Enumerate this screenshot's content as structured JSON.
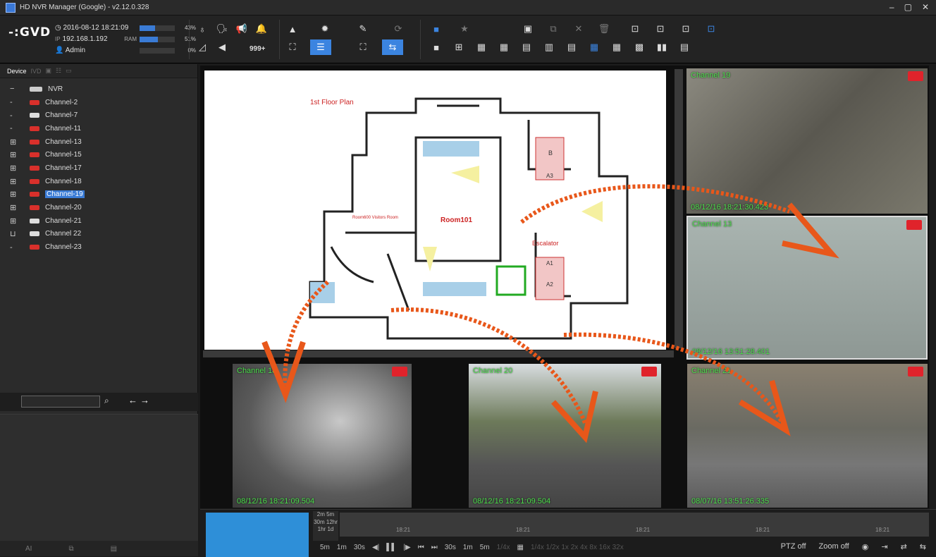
{
  "window": {
    "title": "HD NVR Manager (Google) - v2.12.0.328",
    "controls": [
      "–",
      "▢",
      "✕"
    ]
  },
  "toolbar": {
    "logo": "GVD",
    "datetime": "2016-08-12  18:21:09",
    "ip_label": "IP",
    "ip": "192.168.1.192",
    "user": "Admin",
    "meters": [
      {
        "label": "",
        "pct": "43%",
        "value": 0.43
      },
      {
        "label": "RAM",
        "pct": "51%",
        "value": 0.51
      },
      {
        "label": "",
        "pct": "0%",
        "value": 0.0
      }
    ],
    "alarm_count": "999+"
  },
  "sidebar": {
    "tabs": [
      "Device",
      "IVD",
      "▣",
      "☷",
      "▭"
    ],
    "root": "NVR",
    "channels": [
      {
        "pre": "-",
        "label": "Channel-2",
        "cam": "red",
        "selected": false
      },
      {
        "pre": "-",
        "label": "Channel-7",
        "cam": "white",
        "selected": false
      },
      {
        "pre": "-",
        "label": "Channel-11",
        "cam": "red",
        "selected": false
      },
      {
        "pre": "⊞",
        "label": "Channel-13",
        "cam": "red",
        "selected": false
      },
      {
        "pre": "⊞",
        "label": "Channel-15",
        "cam": "red",
        "selected": false
      },
      {
        "pre": "⊞",
        "label": "Channel-17",
        "cam": "red",
        "selected": false
      },
      {
        "pre": "⊞",
        "label": "Channel-18",
        "cam": "red",
        "selected": false
      },
      {
        "pre": "⊞",
        "label": "Channel-19",
        "cam": "red",
        "selected": true
      },
      {
        "pre": "⊞",
        "label": "Channel-20",
        "cam": "red",
        "selected": false
      },
      {
        "pre": "⊞",
        "label": "Channel-21",
        "cam": "white",
        "selected": false
      },
      {
        "pre": "⊔",
        "label": "Channel 22",
        "cam": "white",
        "selected": false
      },
      {
        "pre": "-",
        "label": "Channel-23",
        "cam": "red",
        "selected": false
      }
    ],
    "search_placeholder": "",
    "footer": [
      "AI",
      "⧉",
      "▤"
    ]
  },
  "map": {
    "title": "1st Floor Plan",
    "labels": [
      "Room101",
      "Escalator",
      "Room600 Visitors Room",
      "B",
      "A3",
      "A1",
      "A2"
    ]
  },
  "videos": [
    {
      "channel": "Channel 19",
      "timestamp": "08/12/16 18:21:30.423"
    },
    {
      "channel": "Channel 13",
      "timestamp": "08/12/16 13:51:28.401"
    },
    {
      "channel": "Channel 18",
      "timestamp": "08/12/16 18:21:09.504"
    },
    {
      "channel": "Channel 20",
      "timestamp": "08/12/16 18:21:09.504"
    },
    {
      "channel": "Channel 21",
      "timestamp": "08/07/16 13:51:26.335"
    }
  ],
  "timeline": {
    "scale": [
      "2m",
      "5m",
      "30m",
      "12hr",
      "1hr",
      "1d"
    ],
    "ticks": [
      "18:21",
      "18:21",
      "18:21",
      "18:21",
      "18:21"
    ],
    "controls": [
      "5m",
      "1m",
      "30s",
      "◀|",
      "▌▌",
      "|▶",
      "⏮",
      "⏭",
      "30s",
      "1m",
      "5m",
      "1/4x",
      "▦"
    ],
    "speeds": "1/4x 1/2x 1x 2x 4x 8x 16x 32x",
    "right": [
      "PTZ off",
      "Zoom off",
      "◉",
      "⇥",
      "⇄",
      "⇆"
    ]
  },
  "colors": {
    "accent": "#3b84e0",
    "osd_green": "#4ee04e",
    "rec_red": "#e0232b",
    "arrow": "#e8571a"
  }
}
